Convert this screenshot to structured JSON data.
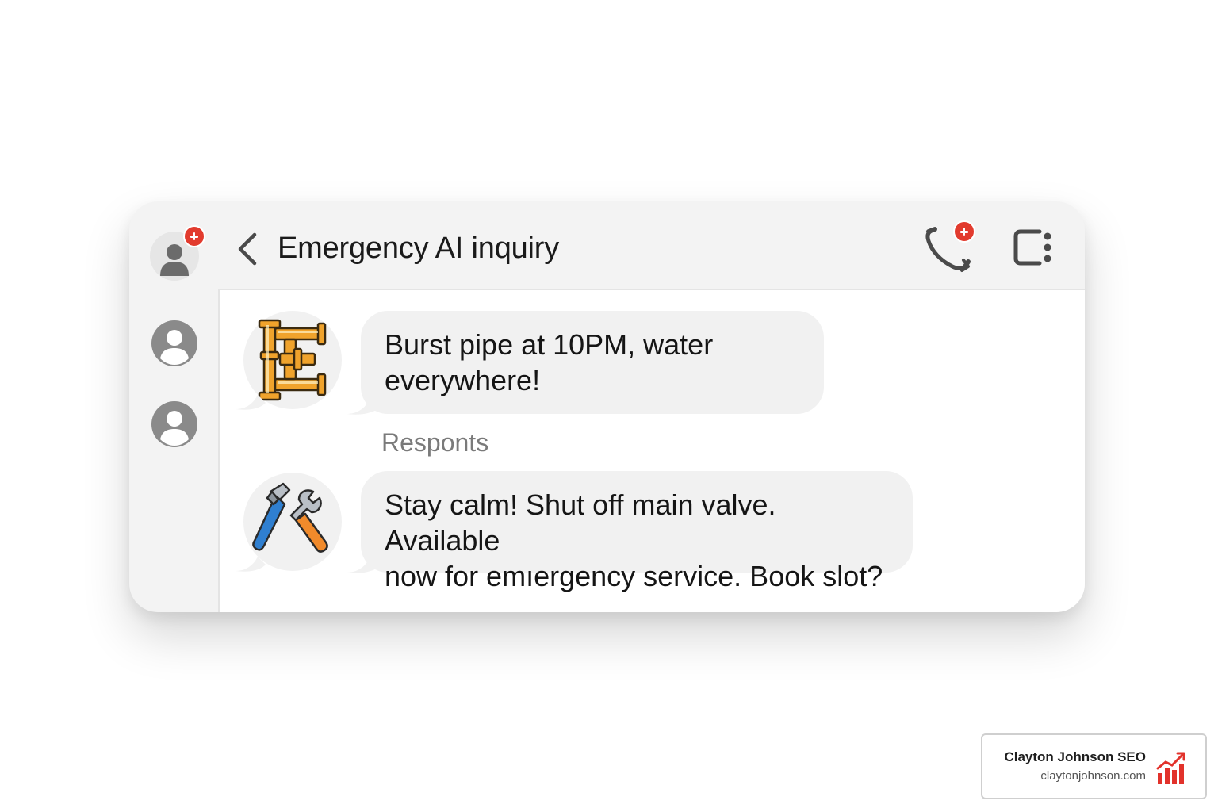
{
  "header": {
    "title": "Emergency AI inquiry",
    "icons": [
      "chevron-left-icon",
      "phone-add-icon",
      "more-options-icon"
    ]
  },
  "sidebar": {
    "contacts": [
      "contact-avatar-active",
      "contact-avatar",
      "contact-avatar"
    ]
  },
  "messages": [
    {
      "sender_icon": "pipe-icon",
      "text": "Burst pipe at 10PM, water everywhere!"
    },
    {
      "label": "Responts",
      "sender_icon": "tools-icon",
      "text_line1": "Stay calm! Shut off main valve. Available",
      "text_line2": "now for emıergency service. Book slot?"
    }
  ],
  "watermark": {
    "name": "Clayton Johnson SEO",
    "url": "claytonjohnson.com"
  },
  "colors": {
    "badge": "#e23b2e",
    "bubble": "#f1f1f1",
    "window": "#f3f3f3",
    "pipe": "#f0a32c",
    "tool_blue": "#2f7fd0",
    "tool_orange": "#f08a2b",
    "brand_red": "#e2322b"
  }
}
